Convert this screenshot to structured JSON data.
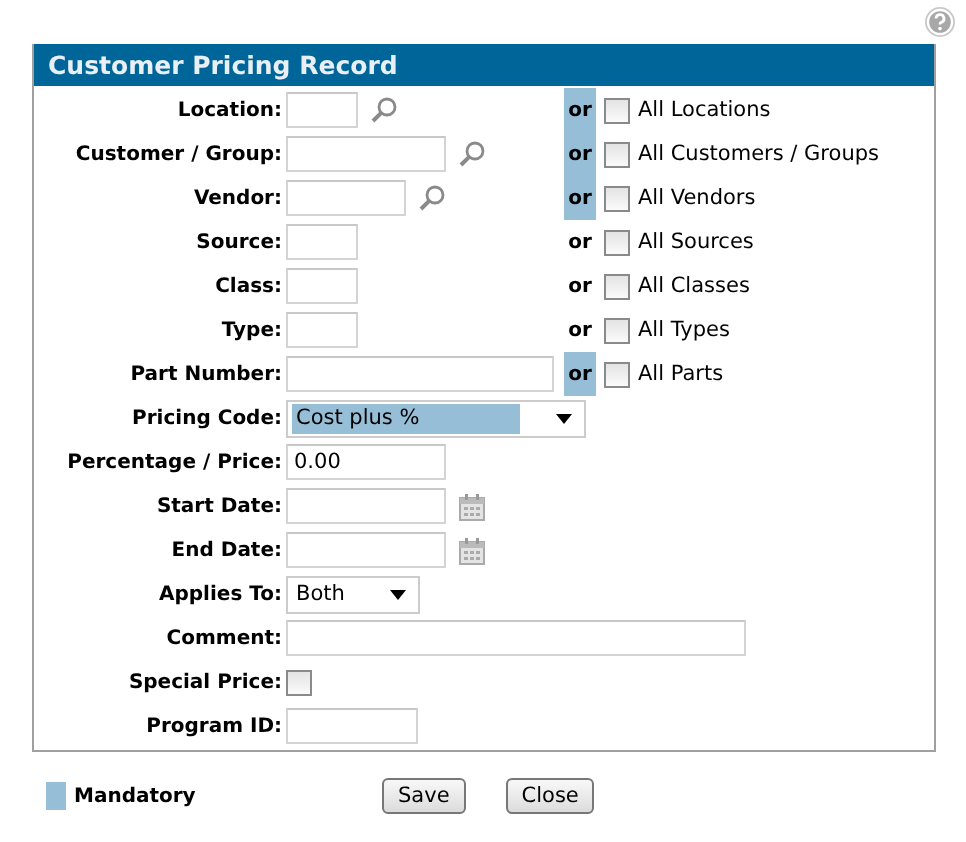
{
  "panel": {
    "title": "Customer Pricing Record"
  },
  "rows": [
    {
      "label": "Location:",
      "kind": "text",
      "lookup": true,
      "mandatory": true,
      "or": "or",
      "all_option": {
        "label": "All Locations",
        "checked": false
      }
    },
    {
      "label": "Customer / Group:",
      "kind": "text",
      "lookup": true,
      "mandatory": true,
      "or": "or",
      "all_option": {
        "label": "All Customers / Groups",
        "checked": false
      }
    },
    {
      "label": "Vendor:",
      "kind": "text",
      "lookup": true,
      "mandatory": true,
      "or": "or",
      "all_option": {
        "label": "All Vendors",
        "checked": false
      }
    },
    {
      "label": "Source:",
      "kind": "text",
      "mandatory": false,
      "or": "or",
      "all_option": {
        "label": "All Sources",
        "checked": false
      }
    },
    {
      "label": "Class:",
      "kind": "text",
      "mandatory": false,
      "or": "or",
      "all_option": {
        "label": "All Classes",
        "checked": false
      }
    },
    {
      "label": "Type:",
      "kind": "text",
      "mandatory": false,
      "or": "or",
      "all_option": {
        "label": "All Types",
        "checked": false
      }
    },
    {
      "label": "Part Number:",
      "kind": "text",
      "mandatory": true,
      "or": "or",
      "all_option": {
        "label": "All Parts",
        "checked": false
      }
    },
    {
      "label": "Pricing Code:",
      "kind": "select",
      "mandatory": true,
      "value": "Cost plus %"
    },
    {
      "label": "Percentage / Price:",
      "kind": "text",
      "value": "0.00"
    },
    {
      "label": "Start Date:",
      "kind": "date"
    },
    {
      "label": "End Date:",
      "kind": "date"
    },
    {
      "label": "Applies To:",
      "kind": "select",
      "mandatory": false,
      "value": "Both"
    },
    {
      "label": "Comment:",
      "kind": "text"
    },
    {
      "label": "Special Price:",
      "kind": "checkbox",
      "checked": false
    },
    {
      "label": "Program ID:",
      "kind": "text"
    }
  ],
  "legend": {
    "label": "Mandatory"
  },
  "buttons": [
    "Save",
    "Close"
  ]
}
